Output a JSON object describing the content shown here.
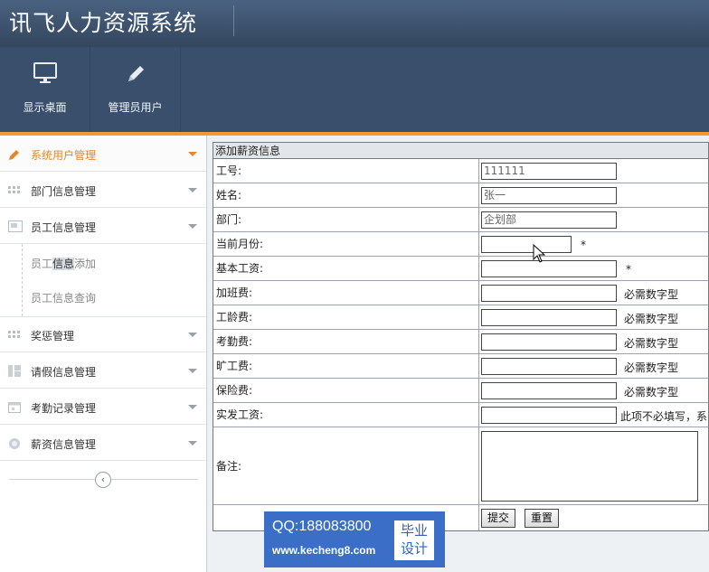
{
  "app": {
    "title": "讯飞人力资源系统"
  },
  "toolbar": {
    "items": [
      {
        "label": "显示桌面",
        "icon": "monitor-icon"
      },
      {
        "label": "管理员用户",
        "icon": "pencil-icon"
      }
    ]
  },
  "sidebar": {
    "items": [
      {
        "label": "系统用户管理",
        "icon": "pencil-icon",
        "active": true
      },
      {
        "label": "部门信息管理",
        "icon": "grid-icon"
      },
      {
        "label": "员工信息管理",
        "icon": "card-icon"
      },
      {
        "label": "奖惩管理",
        "icon": "grid-icon"
      },
      {
        "label": "请假信息管理",
        "icon": "columns-icon"
      },
      {
        "label": "考勤记录管理",
        "icon": "calendar-icon"
      },
      {
        "label": "薪资信息管理",
        "icon": "globe-icon"
      }
    ],
    "sub_items": [
      {
        "pre": "员工",
        "highlight": "信息",
        "post": "添加"
      },
      {
        "label": "员工信息查询"
      }
    ]
  },
  "form": {
    "title": "添加薪资信息",
    "rows": [
      {
        "label": "工号:",
        "value": "111111"
      },
      {
        "label": "姓名:",
        "value": "张一"
      },
      {
        "label": "部门:",
        "value": "企划部"
      },
      {
        "label": "当前月份:",
        "value": "",
        "note": "*"
      },
      {
        "label": "基本工资:",
        "value": "",
        "note": "*"
      },
      {
        "label": "加班费:",
        "value": "",
        "note": "必需数字型"
      },
      {
        "label": "工龄费:",
        "value": "",
        "note": "必需数字型"
      },
      {
        "label": "考勤费:",
        "value": "",
        "note": "必需数字型"
      },
      {
        "label": "旷工费:",
        "value": "",
        "note": "必需数字型"
      },
      {
        "label": "保险费:",
        "value": "",
        "note": "必需数字型"
      },
      {
        "label": "实发工资:",
        "value": "",
        "note": "此项不必填写，系"
      }
    ],
    "remark_label": "备注:",
    "submit_label": "提交",
    "reset_label": "重置"
  },
  "watermark": {
    "qq": "QQ:188083800",
    "url": "www.kecheng8.com",
    "badge_line1": "毕业",
    "badge_line2": "设计"
  }
}
